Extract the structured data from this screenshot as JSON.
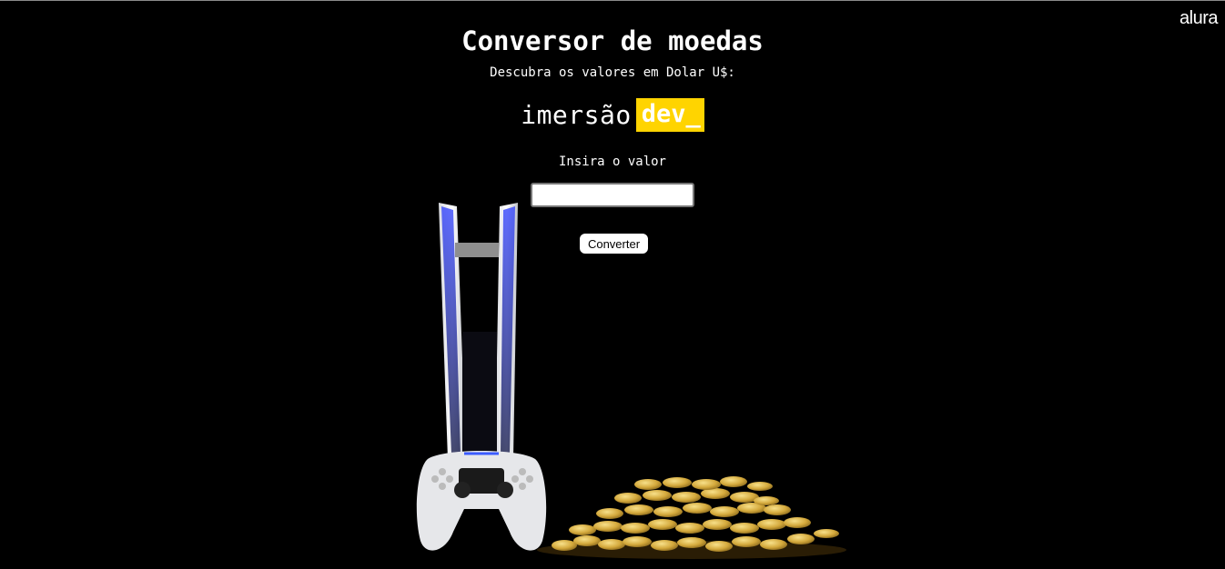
{
  "header": {
    "logo_text": "alura",
    "title": "Conversor de moedas",
    "subtitle": "Descubra os valores em Dolar U$:"
  },
  "brand": {
    "word": "imersão",
    "highlight": "dev_",
    "highlight_color": "#ffd400"
  },
  "form": {
    "label": "Insira o valor",
    "input_value": "",
    "input_placeholder": "",
    "button_label": "Converter"
  },
  "illustration": {
    "icons": [
      "game-console-icon",
      "game-controller-icon",
      "gold-coins-icon"
    ]
  }
}
